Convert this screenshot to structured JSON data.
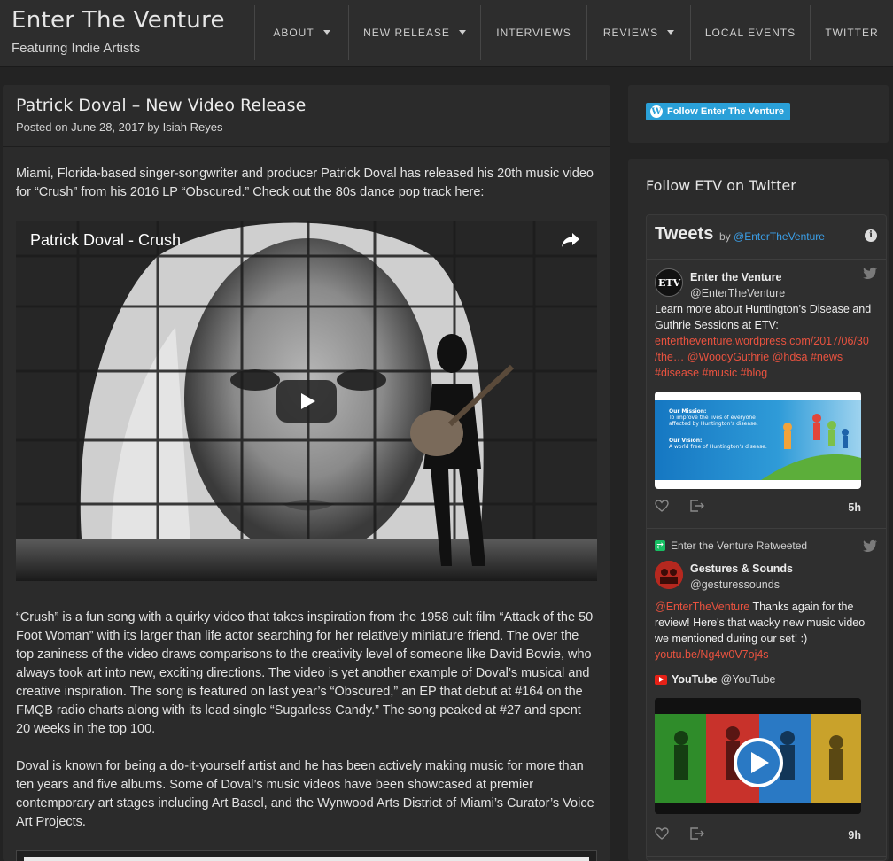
{
  "site": {
    "title": "Enter The Venture",
    "tagline": "Featuring Indie Artists"
  },
  "nav": [
    {
      "label": "About",
      "dropdown": true
    },
    {
      "label": "New Release",
      "dropdown": true
    },
    {
      "label": "Interviews",
      "dropdown": false
    },
    {
      "label": "Reviews",
      "dropdown": true
    },
    {
      "label": "Local Events",
      "dropdown": false
    },
    {
      "label": "Twitter",
      "dropdown": false
    }
  ],
  "article": {
    "title": "Patrick Doval – New Video Release",
    "meta_prefix": "Posted on",
    "date": "June 28, 2017",
    "meta_by": "by",
    "author": "Isiah Reyes",
    "paragraphs": [
      "Miami, Florida-based singer-songwriter and producer Patrick Doval has released his 20th music video for “Crush” from his 2016 LP “Obscured.” Check out the 80s dance pop track here:",
      "“Crush” is a fun song with a quirky video that takes inspiration from the 1958 cult film “Attack of the 50 Foot Woman” with its larger than life actor searching for her relatively miniature friend. The over the top zaniness of the video draws comparisons to the creativity level of someone like David Bowie, who always took art into new, exciting directions. The video is yet another example of Doval’s musical and creative inspiration. The song is featured on last year’s “Obscured,” an EP that debut at #164 on the FMQB radio charts along with its lead single “Sugarless Candy.” The song peaked at #27 and spent 20 weeks in the top 100.",
      "Doval is known for being a do-it-yourself artist and he has been actively making music for more than ten years and five albums. Some of Doval’s music videos have been showcased at premier contemporary art stages including Art Basel, and the Wynwood Arts District of Miami’s Curator’s Voice Art Projects."
    ],
    "video_title": "Patrick Doval - Crush"
  },
  "sidebar": {
    "follow_button": "Follow Enter The Venture",
    "twitter_widget_title": "Follow ETV on Twitter",
    "timeline": {
      "heading": "Tweets",
      "by": "by",
      "account": "@EnterTheVenture",
      "tweets": [
        {
          "name": "Enter the Venture",
          "handle": "@EnterTheVenture",
          "avatar_text": "ETV",
          "text_plain": "Learn more about Huntington's Disease and Guthrie Sessions at ETV:",
          "links": "enterthventure.wordpress.com/2017/06/30/the… @WoodyGuthrie @hdsa #news #disease #music #blog",
          "link1": "entertheventure.wordpress.com/2017/06/30",
          "link2": "/the…",
          "link3": "@WoodyGuthrie",
          "link4": "@hdsa",
          "link5": "#news",
          "link6": "#disease",
          "link7": "#music",
          "link8": "#blog",
          "media_mission_title": "Our Mission:",
          "media_mission_text1": "To improve the lives of everyone",
          "media_mission_text2": "affected by Huntington's disease.",
          "media_vision_title": "Our Vision:",
          "media_vision_text": "A world free of Huntington's disease.",
          "time": "5h"
        },
        {
          "retweet_label": "Enter the Venture Retweeted",
          "name": "Gestures & Sounds",
          "handle": "@gesturessounds",
          "mention": "@EnterTheVenture",
          "text_rest1": " Thanks again for the",
          "text_rest2": "review! Here's that wacky new music video",
          "text_rest3": "we mentioned during our set! :)",
          "link": "youtu.be/Ng4w0V7oj4s",
          "card_source": "YouTube",
          "card_handle": "@YouTube",
          "time": "9h"
        }
      ]
    }
  },
  "colors": {
    "link_red": "#e8523f",
    "twitter_blue": "#3b9fe8",
    "follow_blue": "#2aa0d8",
    "retweet_green": "#17bf63"
  }
}
